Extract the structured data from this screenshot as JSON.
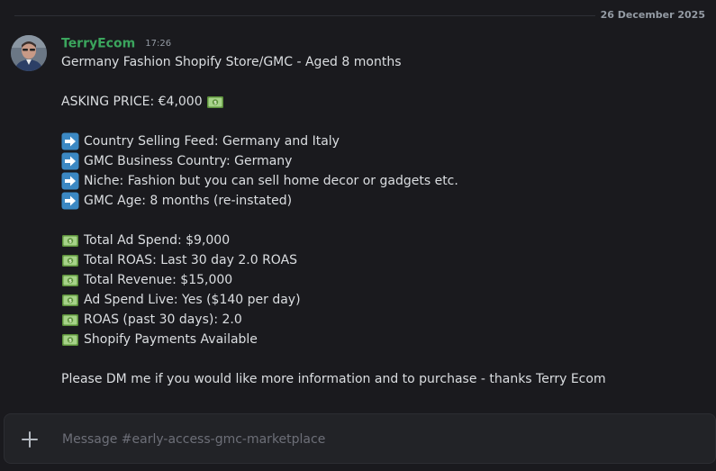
{
  "date_divider": "26 December 2025",
  "message": {
    "username": "TerryEcom",
    "time": "17:26",
    "avatar_icon": "user-avatar-photo",
    "lines": {
      "title": "Germany Fashion Shopify Store/GMC - Aged 8 months",
      "asking_price": "ASKING PRICE: €4,000",
      "country_feed": "Country Selling Feed: Germany and Italy",
      "gmc_country": "GMC Business Country: Germany",
      "niche": "Niche: Fashion but you can sell home decor or gadgets etc.",
      "gmc_age": "GMC Age: 8 months (re-instated)",
      "ad_spend": "Total Ad Spend: $9,000",
      "total_roas": "Total ROAS: Last 30 day 2.0 ROAS",
      "revenue": "Total Revenue: $15,000",
      "ad_spend_live": "Ad Spend Live: Yes ($140 per day)",
      "roas_30": "ROAS (past 30 days): 2.0",
      "payments": "Shopify Payments Available",
      "closing": "Please DM me if you would like more information and to purchase - thanks Terry Ecom"
    },
    "emojis": {
      "arrow": "arrow-right-emoji",
      "money": "dollar-banknote-emoji"
    }
  },
  "composer": {
    "placeholder": "Message #early-access-gmc-marketplace",
    "plus_icon": "plus-icon"
  },
  "colors": {
    "background": "#1a1a1e",
    "username": "#3ba55d",
    "text": "#dbdee1",
    "muted": "#949ba4",
    "arrow_emoji": "#3b88c3",
    "money_emoji": "#a6d388"
  }
}
